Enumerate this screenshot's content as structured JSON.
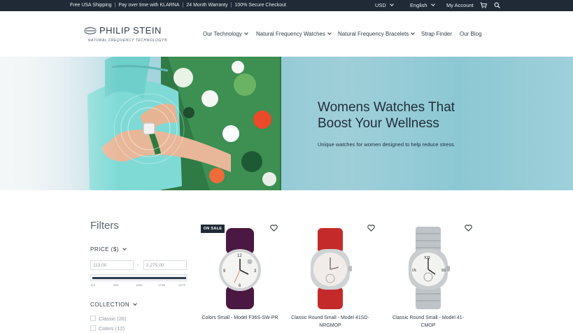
{
  "topbar": {
    "promos": [
      "Free USA Shipping",
      "Pay over time with KLARNA",
      "24 Month Warranty",
      "100% Secure Checkout"
    ],
    "currency": "USD",
    "language": "English",
    "account": "My Account"
  },
  "header": {
    "brand": "PHILIP STEIN",
    "tagline": "NATURAL FREQUENCY TECHNOLOGY®",
    "nav": [
      "Our Technology",
      "Natural Frequency Watches",
      "Natural Frequency Bracelets",
      "Strap Finder",
      "Our Blog"
    ]
  },
  "hero": {
    "title_line1": "Womens Watches That",
    "title_line2": "Boost Your Wellness",
    "subtitle": "Unique watches for women designed to help reduce stress."
  },
  "filters": {
    "title": "Filters",
    "price_label": "PRICE ($)",
    "price_min": "113.00",
    "price_max": "2,275.00",
    "price_sep": "-",
    "ticks": [
      "113",
      "654",
      "1194",
      "1735",
      "2275"
    ],
    "collection_label": "COLLECTION",
    "collections": [
      "Classic (26)",
      "Colors (12)"
    ]
  },
  "products": [
    {
      "name": "Colors Small - Model F36S-SW-PR",
      "badge": "ON SALE",
      "strap": "#4a1840"
    },
    {
      "name": "Classic Round Small - Model 41SD-NRGMOP",
      "strap": "#c42a2a"
    },
    {
      "name": "Classic Round Small - Model 41-CMOP",
      "strap": "#bfc4c8"
    }
  ],
  "colors": {
    "topbar": "#1f2a36",
    "hero_accent": "#8dc7d2",
    "text": "#2f3e4c"
  }
}
